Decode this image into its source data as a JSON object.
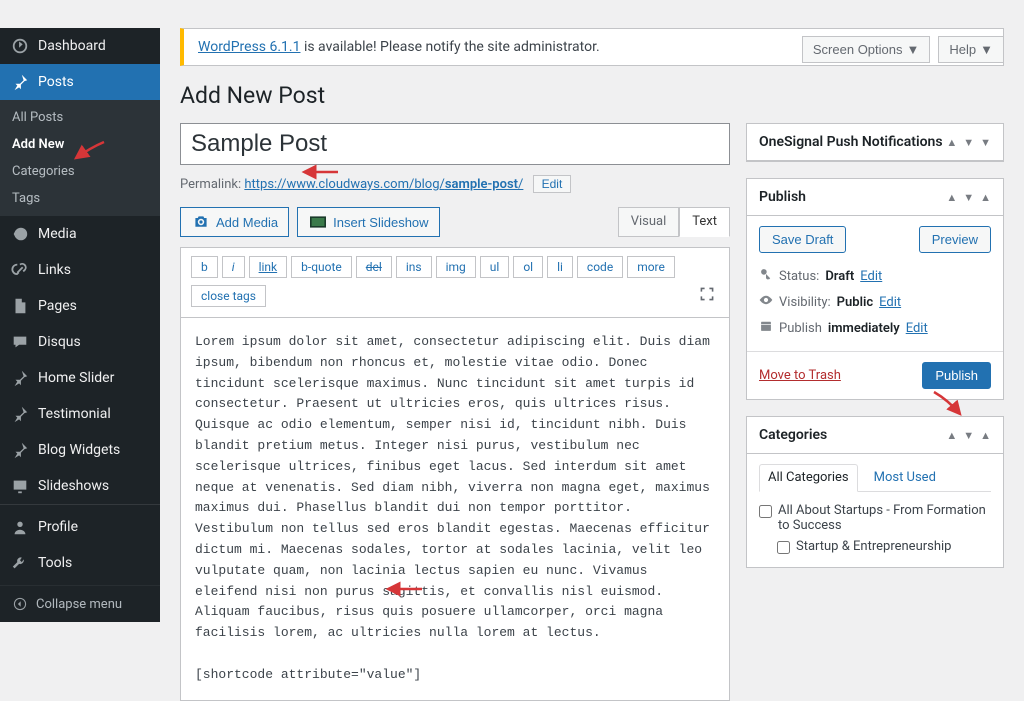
{
  "topbar": {
    "screen_options": "Screen Options",
    "help": "Help"
  },
  "sidebar": {
    "dashboard": "Dashboard",
    "posts": "Posts",
    "posts_sub": [
      "All Posts",
      "Add New",
      "Categories",
      "Tags"
    ],
    "media": "Media",
    "links": "Links",
    "pages": "Pages",
    "disqus": "Disqus",
    "home_slider": "Home Slider",
    "testimonial": "Testimonial",
    "blog_widgets": "Blog Widgets",
    "slideshows": "Slideshows",
    "profile": "Profile",
    "tools": "Tools",
    "collapse": "Collapse menu"
  },
  "notice": {
    "prefix": "WordPress 6.1.1",
    "suffix": " is available! Please notify the site administrator."
  },
  "page_title": "Add New Post",
  "post": {
    "title": "Sample Post",
    "permalink_label": "Permalink",
    "permalink_base": "https://www.cloudways.com/blog/",
    "permalink_slug": "sample-post",
    "permalink_trail": "/",
    "edit": "Edit"
  },
  "media": {
    "add": "Add Media",
    "slideshow": "Insert Slideshow"
  },
  "tabs": {
    "visual": "Visual",
    "text": "Text"
  },
  "toolbar": [
    "b",
    "i",
    "link",
    "b-quote",
    "del",
    "ins",
    "img",
    "ul",
    "ol",
    "li",
    "code",
    "more",
    "close tags"
  ],
  "body": "Lorem ipsum dolor sit amet, consectetur adipiscing elit. Duis diam ipsum, bibendum non rhoncus et, molestie vitae odio. Donec tincidunt scelerisque maximus. Nunc tincidunt sit amet turpis id consectetur. Praesent ut ultricies eros, quis ultrices risus. Quisque ac odio elementum, semper nisi id, tincidunt nibh. Duis blandit pretium metus. Integer nisi purus, vestibulum nec scelerisque ultrices, finibus eget lacus. Sed interdum sit amet neque at venenatis. Sed diam nibh, viverra non magna eget, maximus maximus dui. Phasellus blandit dui non tempor porttitor. Vestibulum non tellus sed eros blandit egestas. Maecenas efficitur dictum mi. Maecenas sodales, tortor at sodales lacinia, velit leo vulputate quam, non lacinia lectus sapien eu nunc. Vivamus eleifend nisi non purus sagittis, et convallis nisl euismod. Aliquam faucibus, risus quis posuere ullamcorper, orci magna facilisis lorem, ac ultricies nulla lorem at lectus.\n\n[shortcode attribute=\"value\"]",
  "onesignal": {
    "title": "OneSignal Push Notifications"
  },
  "publish": {
    "title": "Publish",
    "save_draft": "Save Draft",
    "preview": "Preview",
    "status_label": "Status:",
    "status_value": "Draft",
    "visibility_label": "Visibility:",
    "visibility_value": "Public",
    "schedule_label": "Publish",
    "schedule_value": "immediately",
    "edit": "Edit",
    "trash": "Move to Trash",
    "submit": "Publish"
  },
  "categories": {
    "title": "Categories",
    "all": "All Categories",
    "most_used": "Most Used",
    "items": [
      "All About Startups - From Formation to Success",
      "Startup & Entrepreneurship"
    ]
  }
}
